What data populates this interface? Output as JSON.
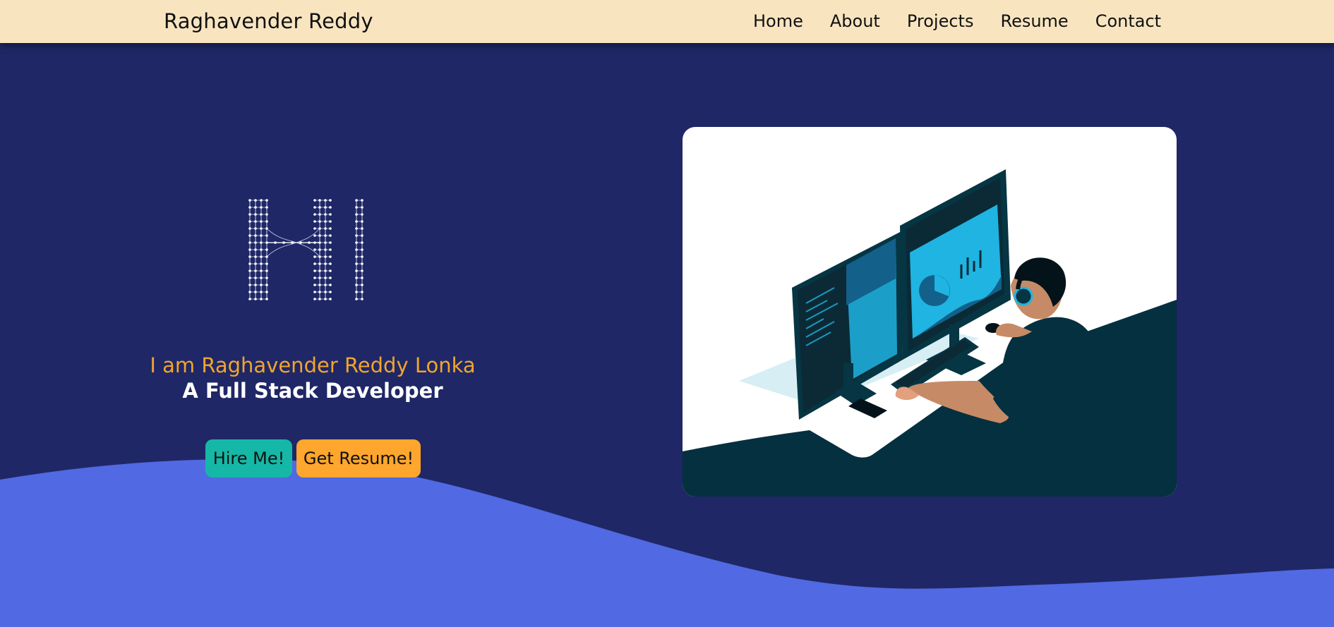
{
  "navbar": {
    "brand": "Raghavender Reddy",
    "links": [
      {
        "label": "Home"
      },
      {
        "label": "About"
      },
      {
        "label": "Projects"
      },
      {
        "label": "Resume"
      },
      {
        "label": "Contact"
      }
    ]
  },
  "hero": {
    "greeting": "Hi",
    "intro_name": "I am Raghavender Reddy Lonka",
    "intro_role": "A Full Stack Developer",
    "buttons": {
      "hire": "Hire Me!",
      "resume": "Get Resume!"
    },
    "illustration_icon": "developer-at-desk-illustration"
  },
  "colors": {
    "navbar_bg": "#f8e5c0",
    "page_bg": "#1f2766",
    "wave": "#5169e2",
    "name_accent": "#f2a52b",
    "hire_button": "#15b8a6",
    "resume_button": "#fea62e"
  }
}
